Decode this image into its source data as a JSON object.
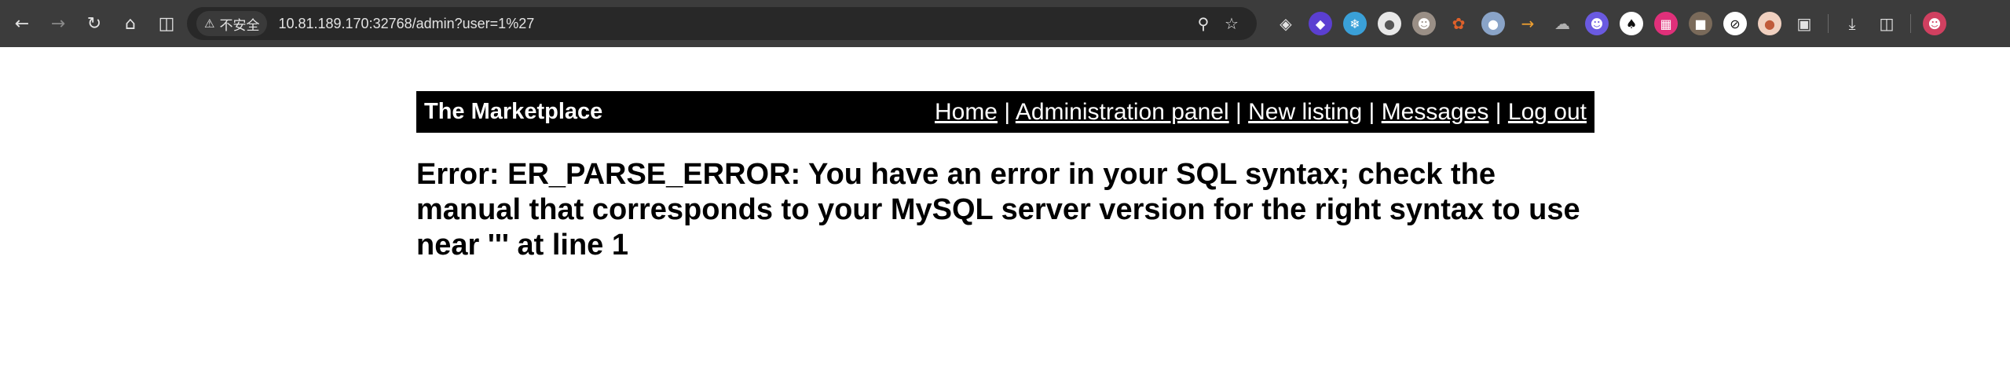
{
  "browser": {
    "security_label": "不安全",
    "url": "10.81.189.170:32768/admin?user=1%27"
  },
  "site": {
    "title": "The Marketplace",
    "nav": [
      "Home",
      "Administration panel",
      "New listing",
      "Messages",
      "Log out"
    ],
    "separator": "|"
  },
  "error": {
    "message": "Error: ER_PARSE_ERROR: You have an error in your SQL syntax; check the manual that corresponds to your MySQL server version for the right syntax to use near ''' at line 1"
  },
  "icons": {
    "back": "arrow-left-icon",
    "forward": "arrow-right-icon",
    "reload": "reload-icon",
    "home": "home-icon",
    "split": "split-view-icon",
    "zoom": "zoom-icon",
    "bookmark": "star-icon",
    "downloads": "download-icon",
    "translate": "translate-icon",
    "profile": "profile-avatar-icon"
  },
  "extension_colors": [
    "#5b3fd1",
    "#3aa0d8",
    "#e8e8e8",
    "#9a8f86",
    "#e0612a",
    "#8aa4c8",
    "#f0a030",
    "#b0b0b0",
    "#6a5ae0",
    "#222222",
    "#e0307a",
    "#7a6a5a",
    "#333333",
    "#d88a6a"
  ]
}
